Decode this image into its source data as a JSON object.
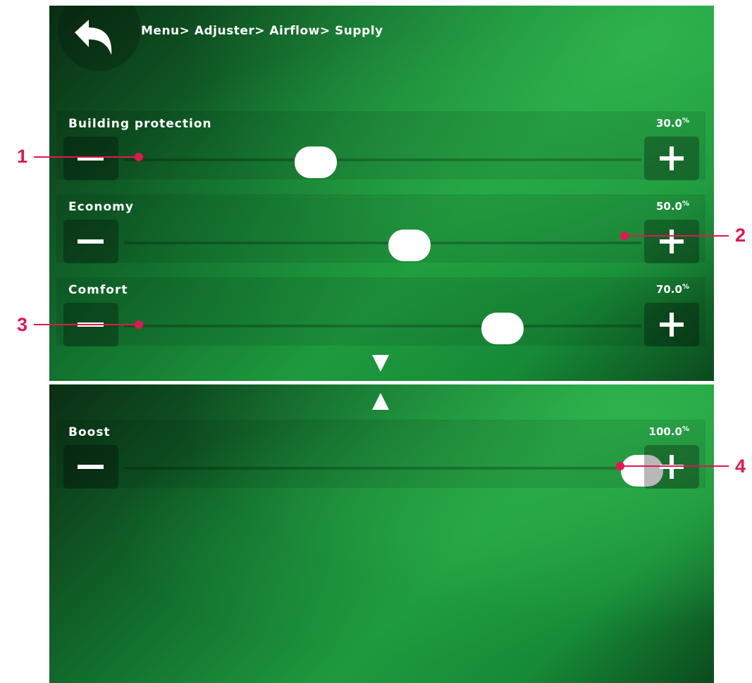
{
  "header": {
    "breadcrumb": "Menu> Adjuster> Airflow> Supply",
    "back_icon": "back-arrow-icon"
  },
  "sliders": [
    {
      "label": "Building protection",
      "value": "30.0",
      "unit": "%",
      "level": 0.3
    },
    {
      "label": "Economy",
      "value": "50.0",
      "unit": "%",
      "level": 0.5
    },
    {
      "label": "Comfort",
      "value": "70.0",
      "unit": "%",
      "level": 0.7
    },
    {
      "label": "Boost",
      "value": "100.0",
      "unit": "%",
      "level": 1.0
    }
  ],
  "navigation": {
    "down_icon": "triangle-down-icon",
    "up_icon": "triangle-up-icon"
  },
  "callouts": [
    "1",
    "2",
    "3",
    "4"
  ],
  "colors": {
    "callout": "#e3174f",
    "screen_green": "#1e9a3e",
    "text": "#ffffff"
  }
}
